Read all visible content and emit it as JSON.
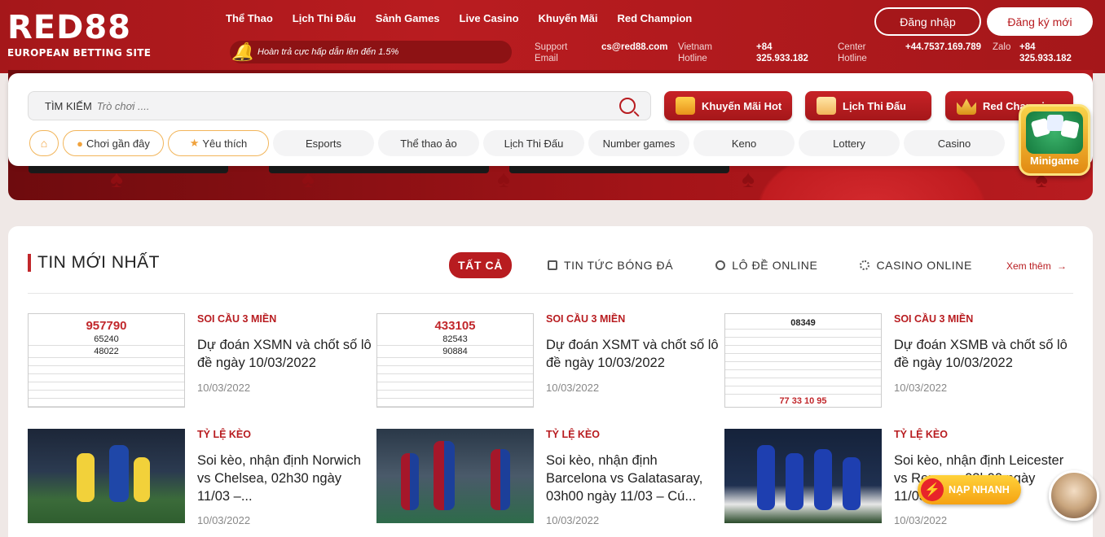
{
  "brand": {
    "logo": "RED88",
    "tagline": "EUROPEAN BETTING SITE"
  },
  "nav": [
    "Thể Thao",
    "Lịch Thi Đấu",
    "Sảnh Games",
    "Live Casino",
    "Khuyến Mãi",
    "Red Champion"
  ],
  "promo": "Hoàn trả cực hấp dẫn lên đến 1.5%",
  "contacts": {
    "support_label": "Support Email",
    "support_value": "cs@red88.com",
    "vn_label": "Vietnam Hotline",
    "vn_value": "+84 325.933.182",
    "center_label": "Center Hotline",
    "center_value": "+44.7537.169.789",
    "zalo_label": "Zalo",
    "zalo_value": "+84 325.933.182"
  },
  "auth": {
    "login": "Đăng nhập",
    "register": "Đăng ký mới"
  },
  "search": {
    "label": "TÌM KIẾM",
    "placeholder": "Trò chơi ...."
  },
  "quick": [
    "Khuyến Mãi Hot",
    "Lịch Thi Đấu",
    "Red Champion"
  ],
  "pills": [
    "Chơi gần đây",
    "Yêu thích",
    "Esports",
    "Thể thao ảo",
    "Lịch Thi Đấu",
    "Number games",
    "Keno",
    "Lottery",
    "Casino"
  ],
  "minigame": "Minigame",
  "news": {
    "title": "TIN MỚI NHẤT",
    "tabs": [
      "TẤT CẢ",
      "TIN TỨC BÓNG ĐÁ",
      "LÔ ĐỀ ONLINE",
      "CASINO ONLINE"
    ],
    "more": "Xem thêm",
    "items": [
      {
        "cat": "SOI CẦU 3 MIỀN",
        "title": "Dự đoán XSMN và chốt số lô đề ngày 10/03/2022",
        "date": "10/03/2022",
        "n1": "957790",
        "n2": "65240",
        "n3": "48022"
      },
      {
        "cat": "SOI CẦU 3 MIỀN",
        "title": "Dự đoán XSMT và chốt số lô đề ngày 10/03/2022",
        "date": "10/03/2022",
        "n1": "433105",
        "n2": "82543",
        "n3": "90884"
      },
      {
        "cat": "SOI CẦU 3 MIỀN",
        "title": "Dự đoán XSMB và chốt số lô đề ngày 10/03/2022",
        "date": "10/03/2022",
        "n1": "08349",
        "n2": "77  33  10  95",
        "n3": ""
      },
      {
        "cat": "TỶ LỆ KÈO",
        "title": "Soi kèo, nhận định Norwich vs Chelsea, 02h30 ngày 11/03 –...",
        "date": "10/03/2022"
      },
      {
        "cat": "TỶ LỆ KÈO",
        "title": "Soi kèo, nhận định Barcelona vs Galatasaray, 03h00 ngày 11/03 – Cú...",
        "date": "10/03/2022"
      },
      {
        "cat": "TỶ LỆ KÈO",
        "title": "Soi kèo, nhận định Leicester vs Rennes, 03h00 ngày 11/03 – Cú...",
        "date": "10/03/2022"
      }
    ]
  },
  "fab": "NẠP NHANH"
}
